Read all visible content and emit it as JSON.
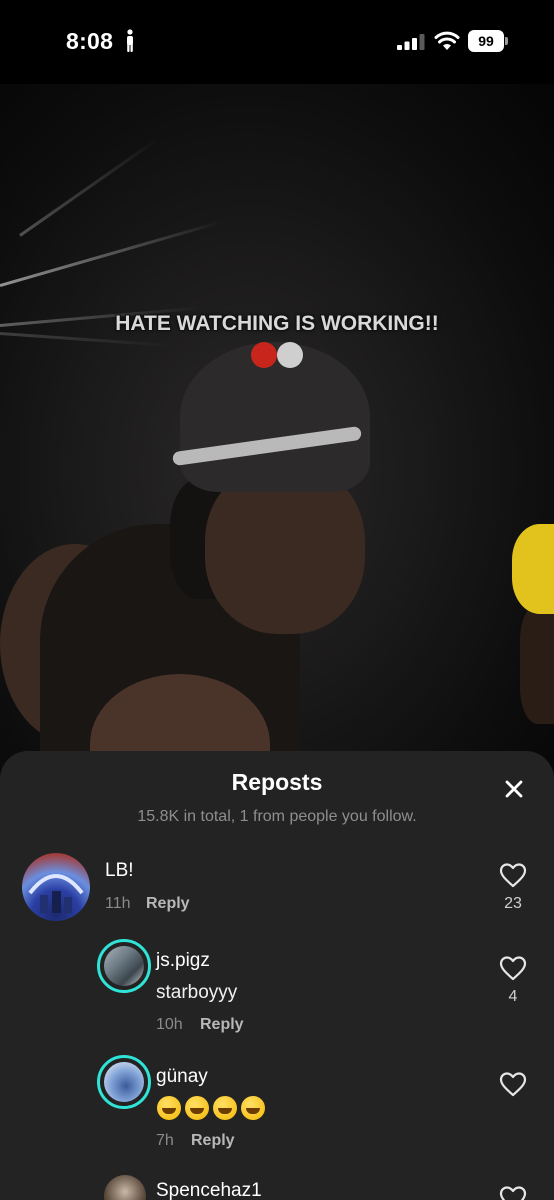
{
  "status_bar": {
    "time": "8:08",
    "battery": "99",
    "icons": [
      "person-standing-icon",
      "signal-icon",
      "wifi-icon",
      "battery-icon"
    ]
  },
  "video": {
    "caption": "HATE WATCHING IS WORKING!!",
    "dots": [
      "#c8261c",
      "#cfcfcf"
    ]
  },
  "reposts": {
    "title": "Reposts",
    "subtitle": "15.8K in total, 1 from people you follow.",
    "close_icon": "close-icon",
    "comments": [
      {
        "name": "LB!",
        "text": "",
        "time": "11h",
        "reply_label": "Reply",
        "likes": "23"
      },
      {
        "name": "js.pigz",
        "text": "starboyyy",
        "time": "10h",
        "reply_label": "Reply",
        "likes": "4"
      },
      {
        "name": "günay",
        "text": "",
        "emoji": [
          "rolling-on-floor-laughing",
          "rolling-on-floor-laughing",
          "rolling-on-floor-laughing",
          "rolling-on-floor-laughing"
        ],
        "time": "7h",
        "reply_label": "Reply",
        "likes": ""
      },
      {
        "name": "Spencehaz1",
        "text": "",
        "time": "",
        "reply_label": "",
        "likes": ""
      }
    ]
  },
  "colors": {
    "sheet_bg": "#232323",
    "story_ring": "#2fe3d7",
    "muted_text": "#8e8e8e"
  }
}
